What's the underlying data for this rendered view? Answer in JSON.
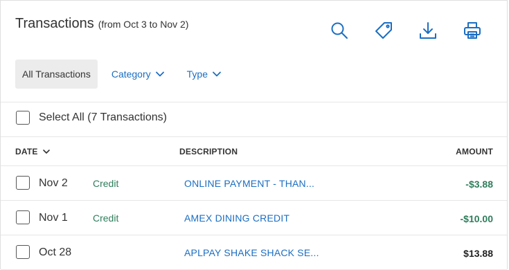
{
  "header": {
    "title": "Transactions",
    "subtitle": "(from Oct 3 to Nov 2)"
  },
  "toolbar": {
    "icons": [
      "search-icon",
      "tag-icon",
      "download-icon",
      "print-icon"
    ],
    "accent": "#1b6ec2"
  },
  "filters": {
    "active_chip": "All Transactions",
    "category_label": "Category",
    "type_label": "Type"
  },
  "selection": {
    "select_all_label": "Select All (7 Transactions)"
  },
  "table": {
    "columns": {
      "date": "DATE",
      "description": "DESCRIPTION",
      "amount": "AMOUNT"
    },
    "rows": [
      {
        "date": "Nov 2",
        "type": "Credit",
        "description": "ONLINE PAYMENT - THAN...",
        "amount": "-$3.88",
        "is_credit": true
      },
      {
        "date": "Nov 1",
        "type": "Credit",
        "description": "AMEX DINING CREDIT",
        "amount": "-$10.00",
        "is_credit": true
      },
      {
        "date": "Oct 28",
        "type": "",
        "description": "APLPAY SHAKE SHACK SE...",
        "amount": "$13.88",
        "is_credit": false
      }
    ]
  },
  "colors": {
    "credit": "#2e7d5b",
    "link": "#1b6ec2",
    "chip_bg": "#ececec"
  }
}
